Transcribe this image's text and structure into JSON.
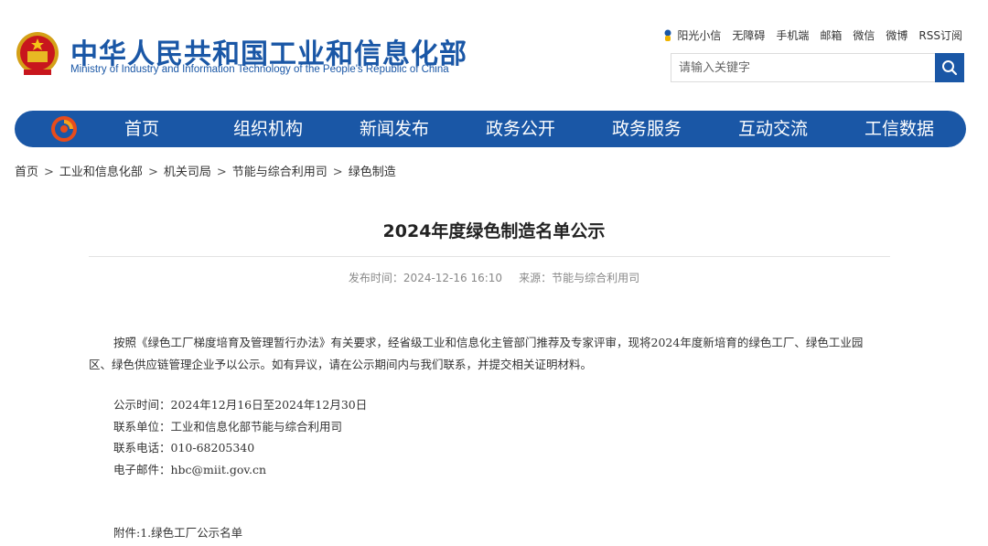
{
  "header": {
    "title": "中华人民共和国工业和信息化部",
    "subtitle": "Ministry of Industry and Information Technology of the People's Republic of China",
    "emblem_icon": "national-emblem-icon",
    "brand_color": "#1a57a6",
    "top_links": [
      "阳光小信",
      "无障碍",
      "手机端",
      "邮箱",
      "微信",
      "微博",
      "RSS订阅"
    ],
    "search": {
      "placeholder": "请输入关键字",
      "icon": "search-icon"
    }
  },
  "nav": {
    "logo_icon": "miit-logo-icon",
    "items": [
      "首页",
      "组织机构",
      "新闻发布",
      "政务公开",
      "政务服务",
      "互动交流",
      "工信数据"
    ]
  },
  "breadcrumb": [
    "首页",
    "工业和信息化部",
    "机关司局",
    "节能与综合利用司",
    "绿色制造"
  ],
  "article": {
    "title": "2024年度绿色制造名单公示",
    "publish_time": "发布时间：2024-12-16 16:10",
    "source": "来源：节能与综合利用司",
    "paragraph_line1": "按照《绿色工厂梯度培育及管理暂行办法》有关要求，经省级工业和信息化主管部门推荐及专家评审，现将2024年度新培育的绿色工厂、绿色工业园",
    "paragraph_line2": "区、绿色供应链管理企业予以公示。如有异议，请在公示期间内与我们联系，并提交相关证明材料。",
    "details": [
      "公示时间：2024年12月16日至2024年12月30日",
      "联系单位：工业和信息化部节能与综合利用司",
      "联系电话：010-68205340",
      "电子邮件：hbc@miit.gov.cn"
    ],
    "attachment": "附件:1.绿色工厂公示名单"
  }
}
